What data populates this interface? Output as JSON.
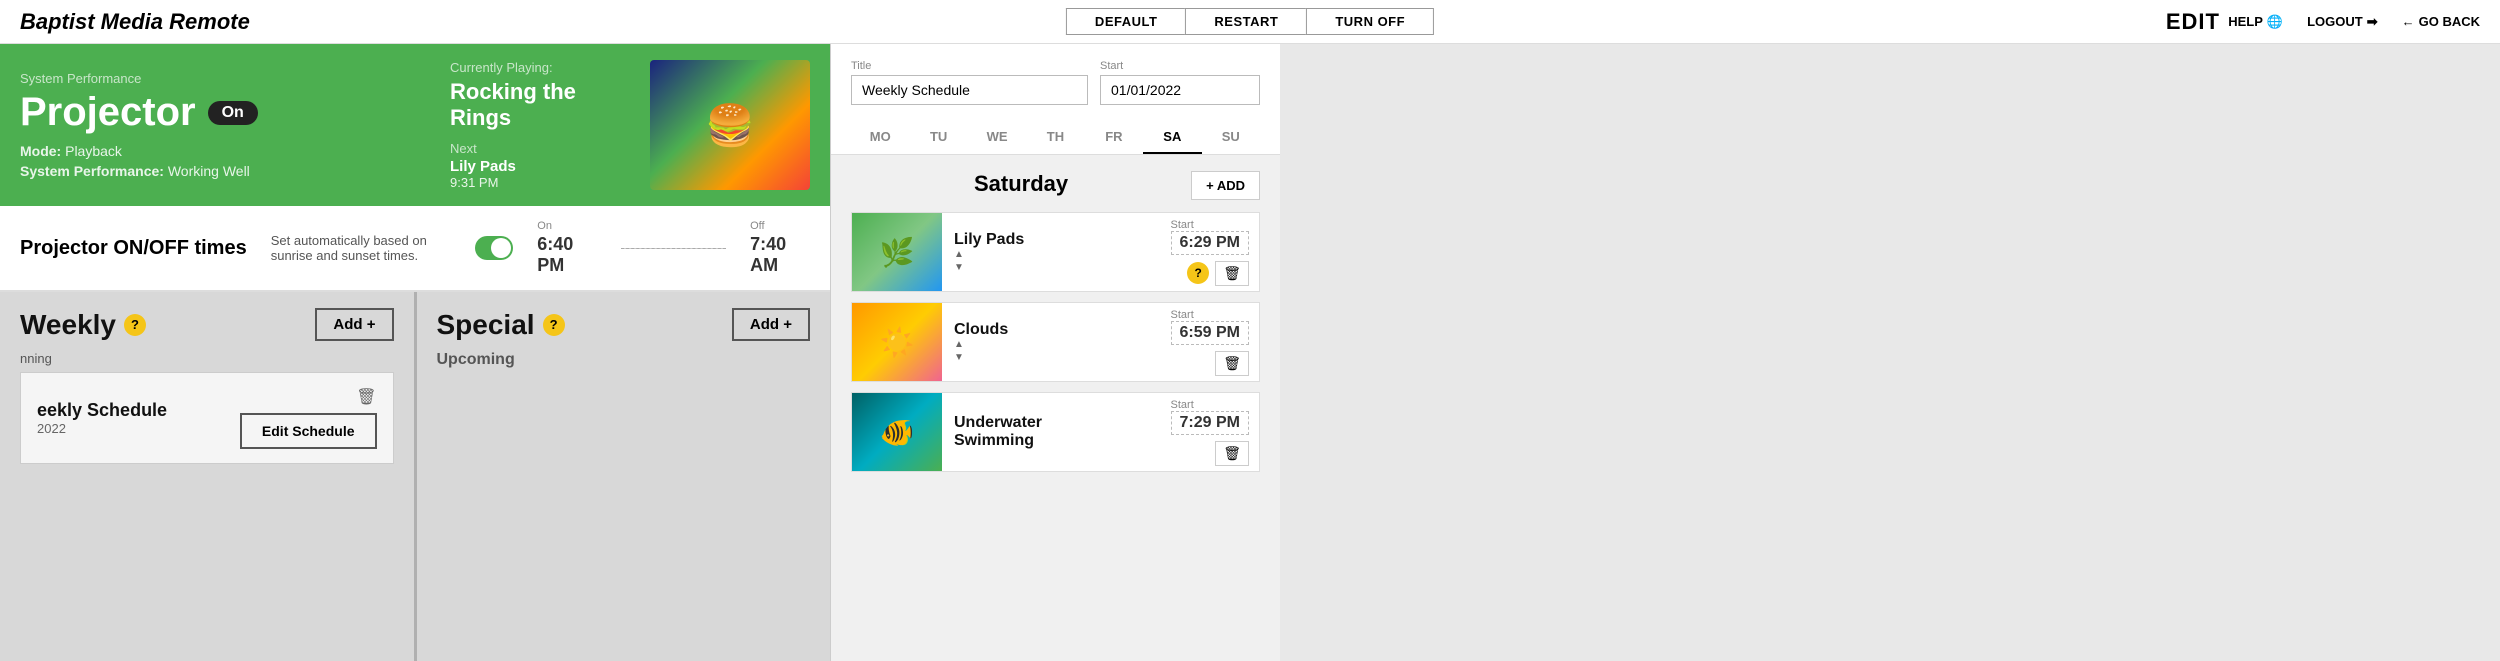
{
  "app": {
    "brand": "Baptist Media Remote",
    "edit_title": "EDIT"
  },
  "nav": {
    "buttons": [
      "DEFAULT",
      "RESTART",
      "TURN OFF"
    ],
    "help": "HELP",
    "logout": "LOGOUT",
    "go_back": "GO BACK"
  },
  "projector": {
    "sys_perf_label": "System Performance",
    "title": "Projector",
    "status": "On",
    "mode_label": "Mode:",
    "mode_value": "Playback",
    "sys_perf_status_label": "System Performance:",
    "sys_perf_status_value": "Working Well",
    "currently_playing_label": "Currently Playing:",
    "currently_playing_title": "Rocking the Rings",
    "next_label": "Next",
    "next_title": "Lily Pads",
    "next_time": "9:31 PM",
    "thumbnail_emoji": "🍔"
  },
  "projector_times": {
    "title": "Projector ON/OFF times",
    "auto_label": "Set automatically based on sunrise and sunset times.",
    "on_label": "On",
    "on_time": "6:40 PM",
    "off_label": "Off",
    "off_time": "7:40 AM"
  },
  "weekly": {
    "title": "Weekly",
    "help": "?",
    "add_btn": "Add +",
    "running_label": "nning",
    "item_title": "eekly Schedule",
    "item_date": "2022",
    "edit_btn": "Edit Schedule",
    "trash": "🗑"
  },
  "special": {
    "title": "Special",
    "help": "?",
    "add_btn": "Add +",
    "upcoming_label": "Upcoming"
  },
  "edit": {
    "title_label": "Title",
    "title_value": "Weekly Schedule",
    "start_label": "Start",
    "start_value": "01/01/2022",
    "days": [
      "MO",
      "TU",
      "WE",
      "TH",
      "FR",
      "SA",
      "SU"
    ],
    "active_day_index": 5,
    "day_title": "Saturday",
    "add_btn": "+ ADD",
    "items": [
      {
        "name": "Lily Pads",
        "start_label": "Start",
        "start_time": "6:29 PM",
        "thumb_class": "thumb-lily",
        "thumb_emoji": "🌿"
      },
      {
        "name": "Clouds",
        "start_label": "Start",
        "start_time": "6:59 PM",
        "thumb_class": "thumb-clouds",
        "thumb_emoji": "☀️"
      },
      {
        "name1": "Underwater",
        "name2": "Swimming",
        "start_label": "Start",
        "start_time": "7:29 PM",
        "thumb_class": "thumb-underwater",
        "thumb_emoji": "🐠"
      }
    ]
  }
}
